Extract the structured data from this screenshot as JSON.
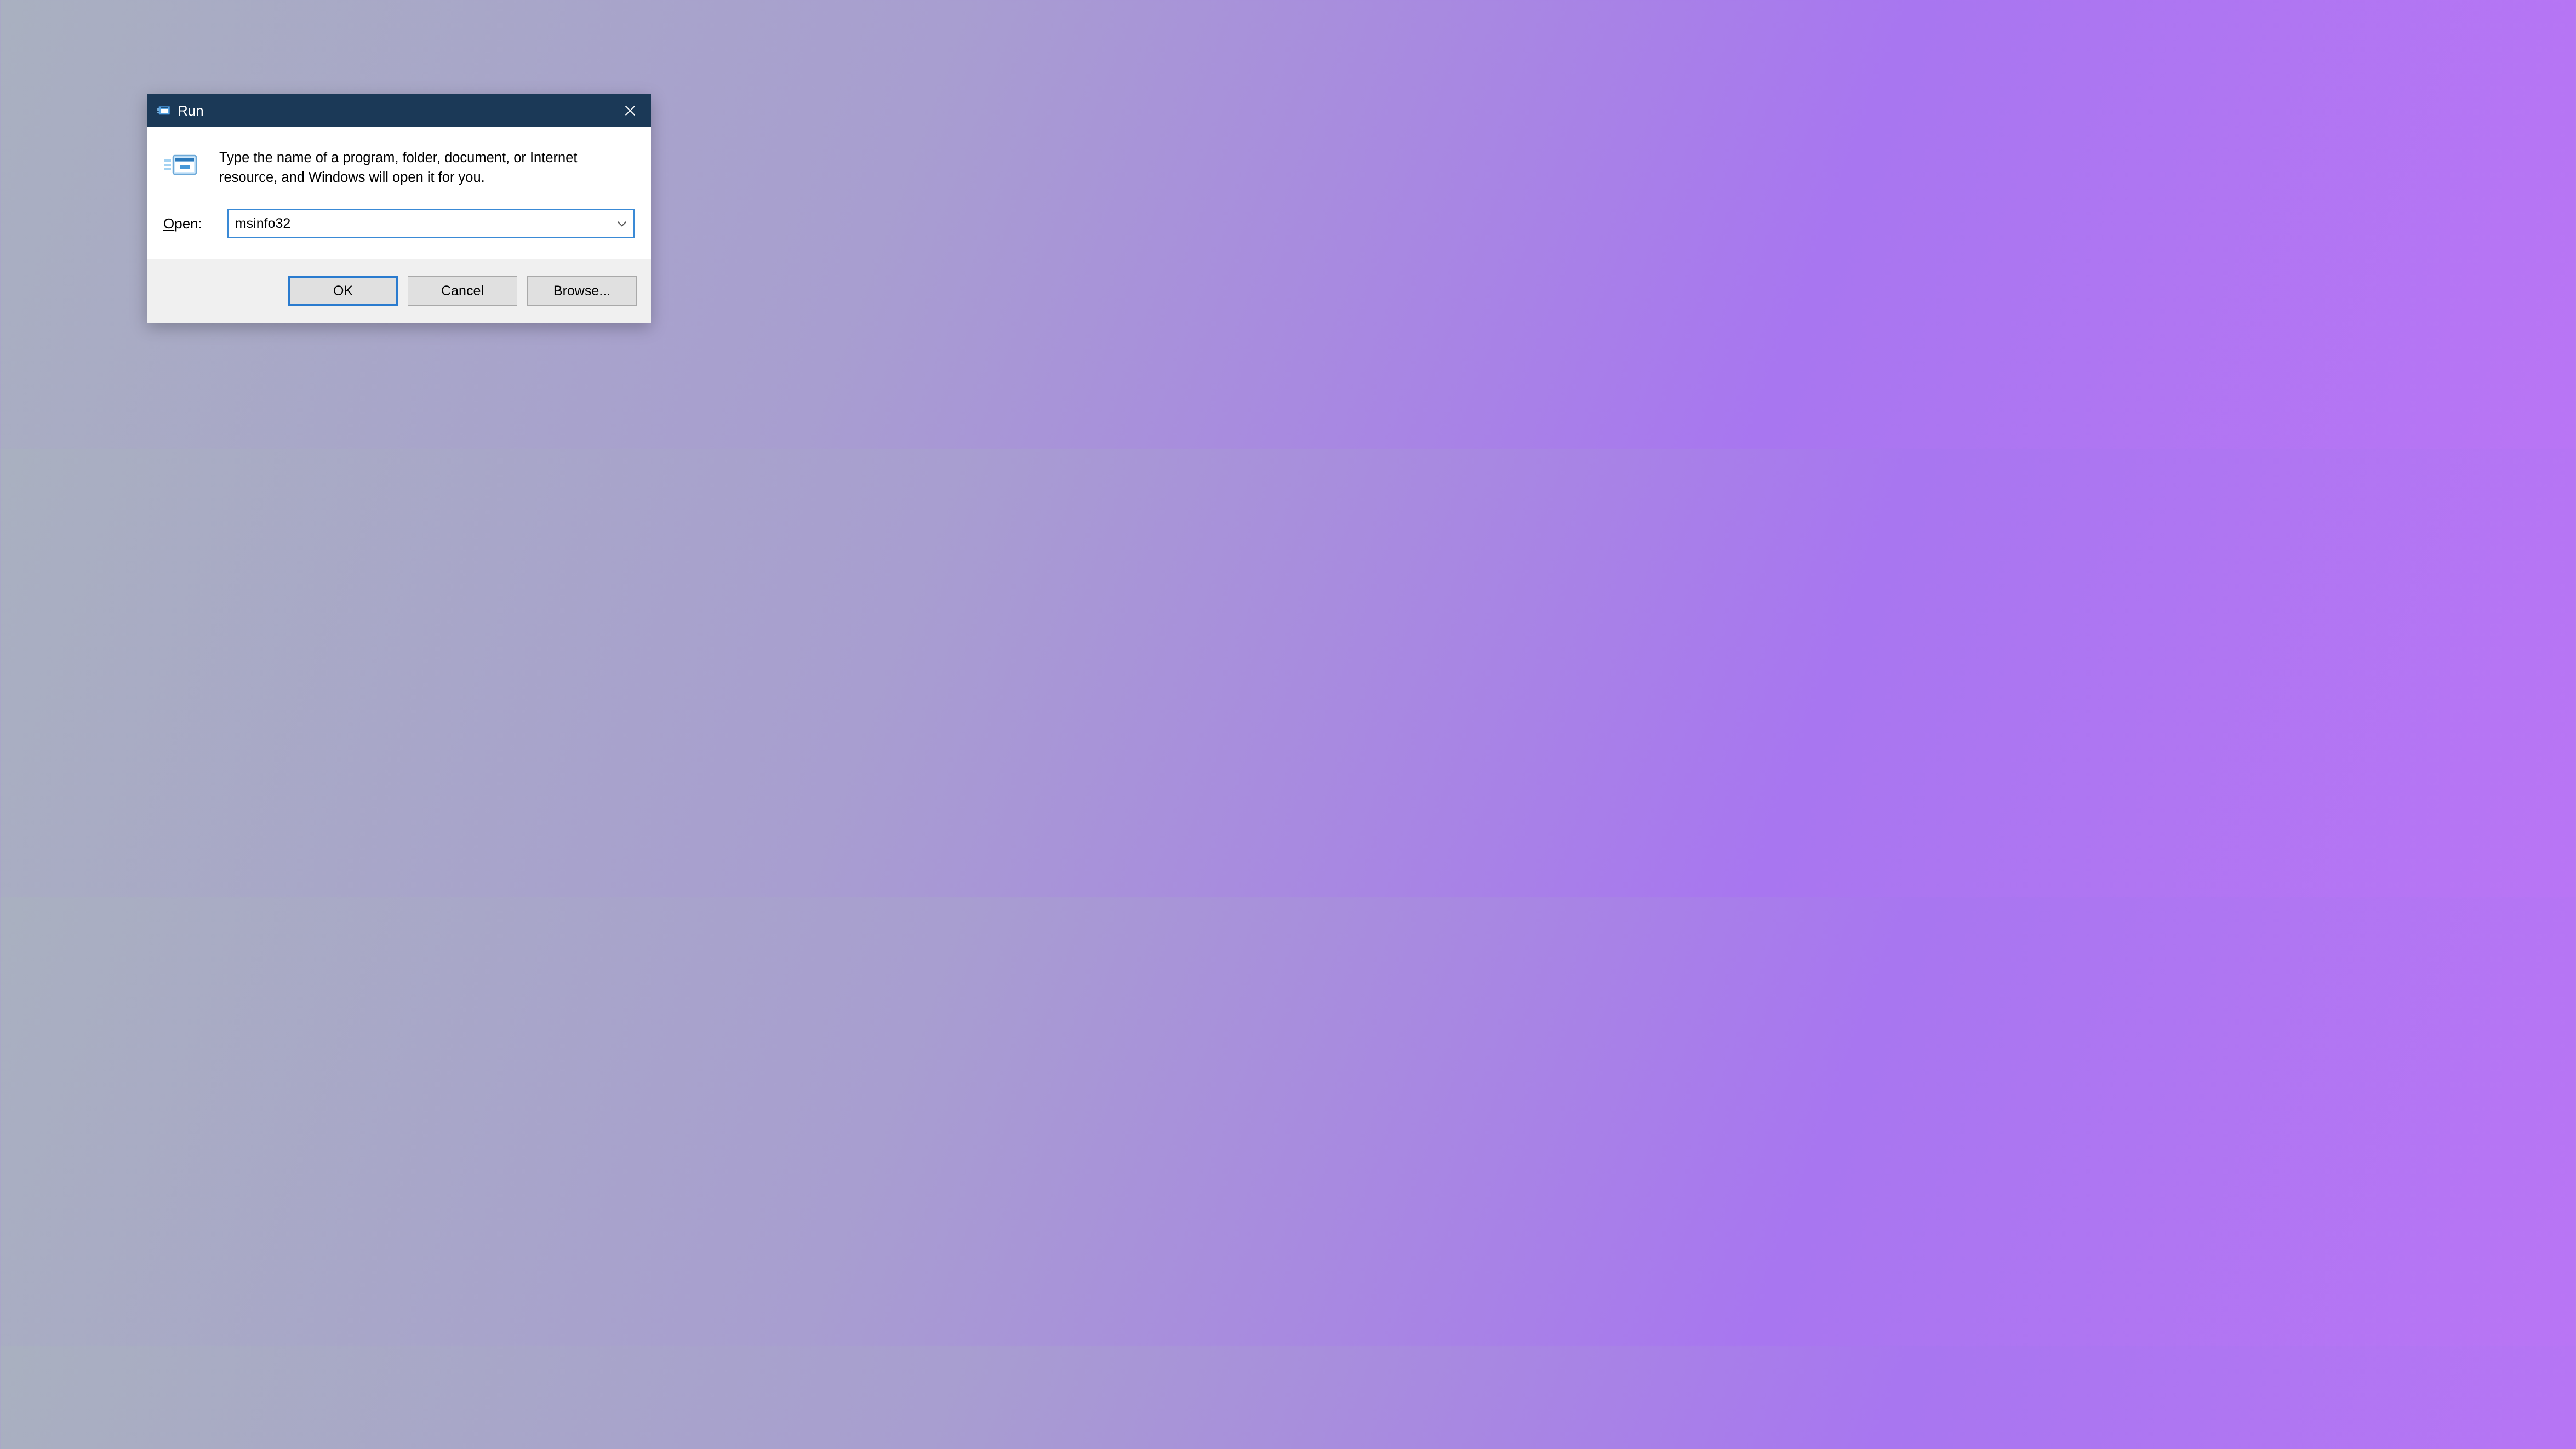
{
  "dialog": {
    "title": "Run",
    "instruction": "Type the name of a program, folder, document, or Internet resource, and Windows will open it for you.",
    "open_label_pre": "O",
    "open_label_post": "pen:",
    "input_value": "msinfo32",
    "buttons": {
      "ok": "OK",
      "cancel": "Cancel",
      "browse": "Browse..."
    }
  }
}
